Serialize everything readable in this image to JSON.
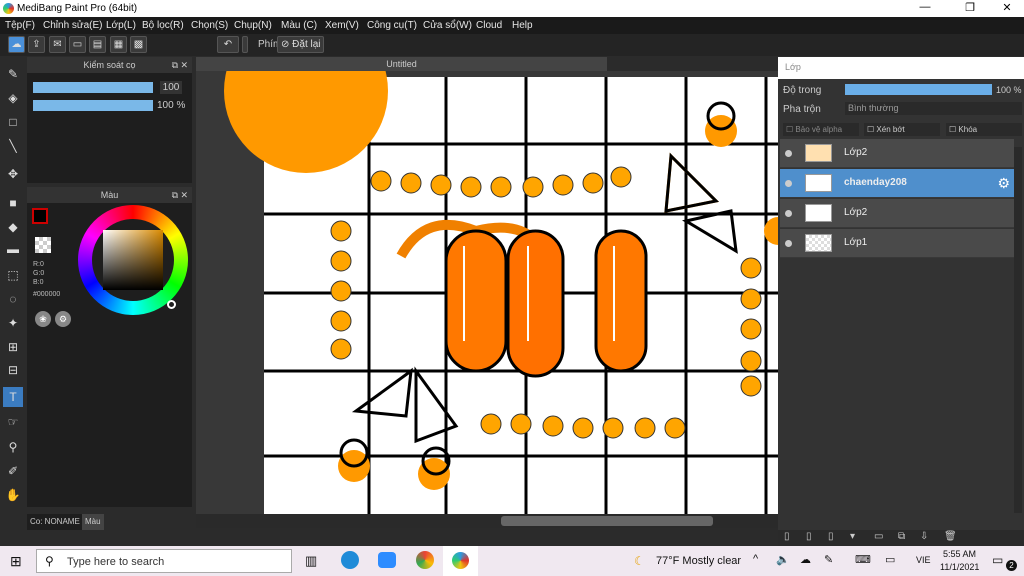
{
  "window": {
    "title": "MediBang Paint Pro (64bit)",
    "min": "—",
    "restore": "❐",
    "close": "✕"
  },
  "menu": [
    "Tệp(F)",
    "Chỉnh sửa(E)",
    "Lớp(L)",
    "Bộ lọc(R)",
    "Chọn(S)",
    "Chụp(N)",
    "Màu (C)",
    "Xem(V)",
    "Công cụ(T)",
    "Cửa sổ(W)",
    "Cloud",
    "Help"
  ],
  "toolbar": {
    "phim_label": "Phím",
    "reset_label": "Đặt lại"
  },
  "brush_panel": {
    "title": "Kiểm soát cọ",
    "size_value": "100",
    "opacity_value": "100 %"
  },
  "color_panel": {
    "title": "Màu",
    "r": "R:0",
    "g": "G:0",
    "b": "B:0",
    "hex": "#000000"
  },
  "left_bottom": {
    "co_label": "Co: NONAME",
    "mau_tab": "Màu"
  },
  "canvas": {
    "doc_title": "Untitled"
  },
  "layers_panel": {
    "title": "Lớp",
    "opacity_label": "Độ trong",
    "opacity_value": "100 %",
    "blend_label": "Pha trộn",
    "blend_value": "Bình thường",
    "protect_alpha": "Bảo vệ alpha",
    "clipping": "Xén bớt",
    "lock": "Khóa",
    "layers": [
      {
        "name": "Lớp2"
      },
      {
        "name": "chaenday208"
      },
      {
        "name": "Lớp2"
      },
      {
        "name": "Lớp1"
      }
    ]
  },
  "taskbar": {
    "search_placeholder": "Type here to search",
    "weather": "77°F  Mostly clear",
    "lang": "VIE",
    "time": "5:55 AM",
    "date": "11/1/2021",
    "notif": "2"
  },
  "colors": {
    "accent": "#4f8fcc",
    "orange": "#ff9900"
  }
}
